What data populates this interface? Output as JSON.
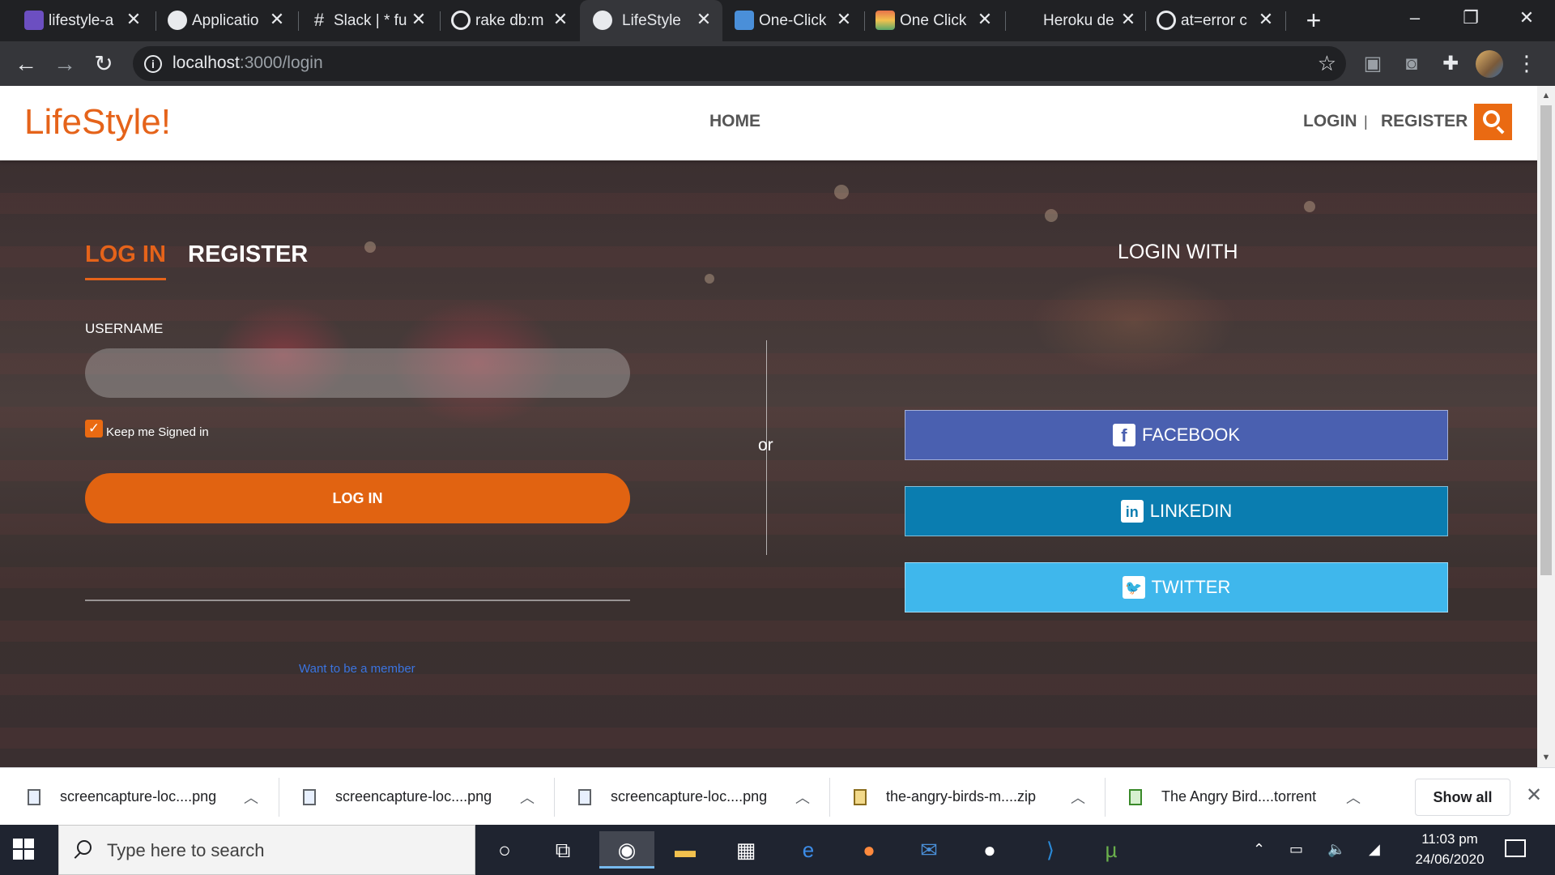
{
  "browser": {
    "tabs": [
      {
        "title": "lifestyle-a",
        "icon": "heroku-icon",
        "color": "#6c4fc1"
      },
      {
        "title": "Applicatio",
        "icon": "globe-icon",
        "color": "#e8eaed"
      },
      {
        "title": "Slack | * fu",
        "icon": "slack-icon",
        "color": "#e8eaed"
      },
      {
        "title": "rake db:m",
        "icon": "google-icon",
        "color": "#e8eaed"
      },
      {
        "title": "LifeStyle",
        "icon": "globe-icon",
        "color": "#e8eaed"
      },
      {
        "title": "One-Click",
        "icon": "image-icon",
        "color": "#4a8fd9"
      },
      {
        "title": "One Click",
        "icon": "rainbow-icon",
        "color": "#e8734a"
      },
      {
        "title": "Heroku de",
        "icon": "blank-icon",
        "color": "#202124"
      },
      {
        "title": "at=error c",
        "icon": "google-icon",
        "color": "#e8eaed"
      }
    ],
    "tab_close": "✕",
    "new_tab": "+",
    "window_controls": {
      "minimize": "–",
      "restore": "❐",
      "close": "✕"
    },
    "nav": {
      "back": "←",
      "forward": "→",
      "reload": "↻"
    },
    "url_host": "localhost",
    "url_path": ":3000/login",
    "star": "☆"
  },
  "site": {
    "logo": "LifeStyle!",
    "nav_home": "HOME",
    "nav_login": "LOGIN",
    "nav_separator": "|",
    "nav_register": "REGISTER"
  },
  "login_form": {
    "tab_login": "LOG IN",
    "tab_register": "REGISTER",
    "username_label": "USERNAME",
    "username_value": "",
    "keep_signed_in_label": "Keep me Signed in",
    "keep_signed_in_checked": true,
    "login_button": "LOG IN",
    "member_link": "Want to be a member"
  },
  "divider_text": "or",
  "social": {
    "heading": "LOGIN WITH",
    "facebook": "FACEBOOK",
    "linkedin": "LINKEDIN",
    "twitter": "TWITTER",
    "facebook_color": "#4a60b0",
    "linkedin_color": "#0a7db0",
    "twitter_color": "#3fb7ec"
  },
  "downloads": {
    "items": [
      {
        "name": "screencapture-loc....png",
        "icon": "image-file-icon"
      },
      {
        "name": "screencapture-loc....png",
        "icon": "image-file-icon"
      },
      {
        "name": "screencapture-loc....png",
        "icon": "image-file-icon"
      },
      {
        "name": "the-angry-birds-m....zip",
        "icon": "zip-file-icon"
      },
      {
        "name": "The Angry Bird....torrent",
        "icon": "torrent-file-icon"
      }
    ],
    "show_all": "Show all"
  },
  "taskbar": {
    "search_placeholder": "Type here to search",
    "time": "11:03 pm",
    "date": "24/06/2020",
    "apps": [
      "cortana-icon",
      "task-view-icon",
      "chrome-icon",
      "file-explorer-icon",
      "store-icon",
      "edge-icon",
      "firefox-icon",
      "mail-icon",
      "github-icon",
      "vscode-icon",
      "utorrent-icon"
    ]
  },
  "colors": {
    "brand_orange": "#e5631a",
    "login_button": "#e16311"
  }
}
